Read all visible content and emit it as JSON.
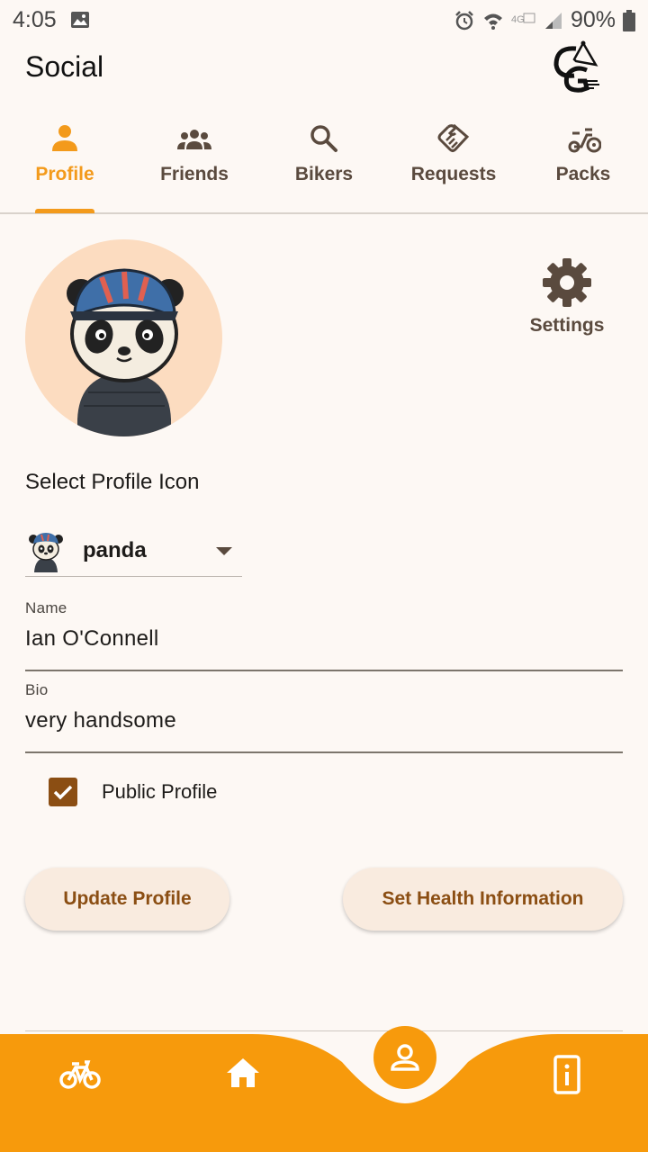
{
  "status_bar": {
    "time": "4:05",
    "battery": "90%"
  },
  "app_bar": {
    "title": "Social"
  },
  "tabs": [
    {
      "label": "Profile",
      "icon": "person-icon",
      "active": true
    },
    {
      "label": "Friends",
      "icon": "group-icon",
      "active": false
    },
    {
      "label": "Bikers",
      "icon": "search-icon",
      "active": false
    },
    {
      "label": "Requests",
      "icon": "handshake-icon",
      "active": false
    },
    {
      "label": "Packs",
      "icon": "scooter-icon",
      "active": false
    }
  ],
  "settings": {
    "label": "Settings"
  },
  "profile_icon": {
    "section_label": "Select Profile Icon",
    "selected": "panda"
  },
  "fields": {
    "name": {
      "label": "Name",
      "value": "Ian O'Connell"
    },
    "bio": {
      "label": "Bio",
      "value": "very handsome"
    }
  },
  "public_profile": {
    "label": "Public Profile",
    "checked": true
  },
  "buttons": {
    "update": "Update Profile",
    "health": "Set Health Information"
  },
  "bottom_nav": [
    {
      "icon": "bike-icon"
    },
    {
      "icon": "home-icon"
    },
    {
      "icon": "profile-icon",
      "active": true
    },
    {
      "icon": "info-icon"
    }
  ],
  "colors": {
    "accent": "#f39a1b",
    "background": "#fdf8f4",
    "nav_bar": "#f79a0c",
    "checkbox": "#8b4e13"
  }
}
